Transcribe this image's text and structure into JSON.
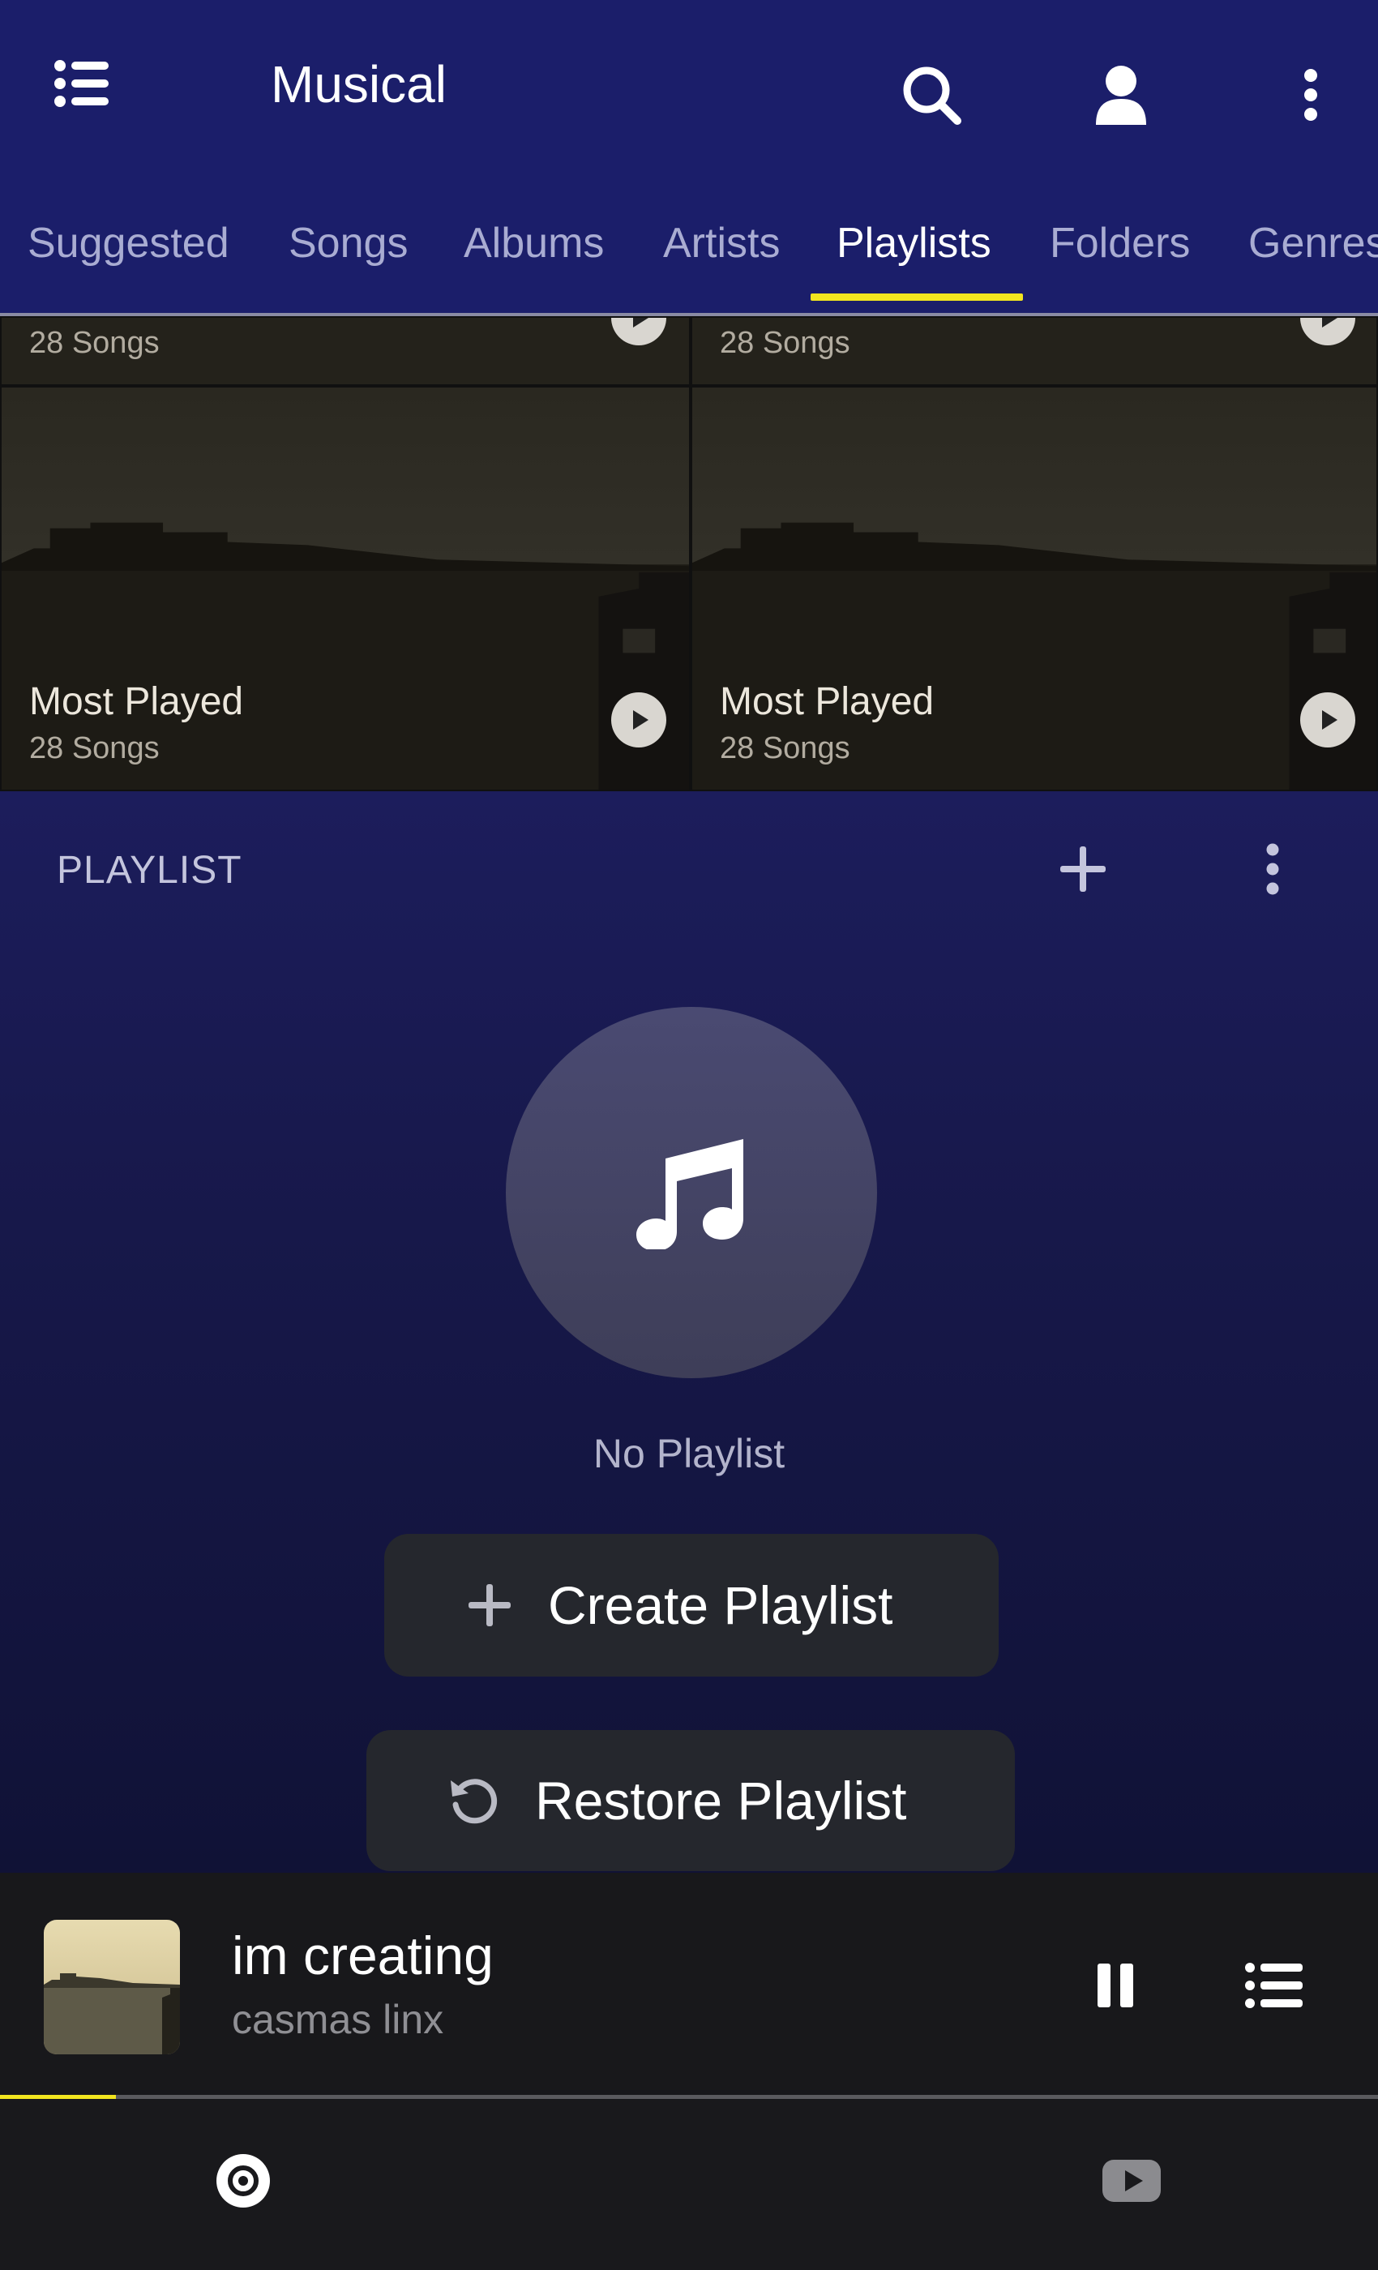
{
  "app": {
    "title": "Musical"
  },
  "tabs": [
    {
      "label": "Suggested"
    },
    {
      "label": "Songs"
    },
    {
      "label": "Albums"
    },
    {
      "label": "Artists"
    },
    {
      "label": "Playlists",
      "active": true
    },
    {
      "label": "Folders"
    },
    {
      "label": "Genres"
    }
  ],
  "grid": {
    "partial_row": [
      {
        "count": "28 Songs"
      },
      {
        "count": "28 Songs"
      }
    ],
    "row": [
      {
        "name": "Most Played",
        "count": "28 Songs"
      },
      {
        "name": "Most Played",
        "count": "28 Songs"
      }
    ]
  },
  "playlist_section": {
    "label": "PLAYLIST",
    "empty_text": "No Playlist",
    "create_label": "Create Playlist",
    "restore_label": "Restore Playlist"
  },
  "now_playing": {
    "title": "im creating",
    "artist": "casmas linx",
    "progress": 0.084
  },
  "icons": {
    "menu": "list-icon",
    "search": "search-icon",
    "account": "user-icon",
    "overflow": "more-vert-icon",
    "play": "play-icon",
    "add": "plus-icon",
    "note": "music-note-icon",
    "restore": "restore-icon",
    "pause": "pause-icon",
    "queue": "queue-icon",
    "disc": "disc-icon",
    "video": "youtube-icon"
  },
  "colors": {
    "appbar": "#1b1e6a",
    "accent": "#f2e51f",
    "tab_inactive": "#a9acd2",
    "panel_dark": "#18181b"
  }
}
